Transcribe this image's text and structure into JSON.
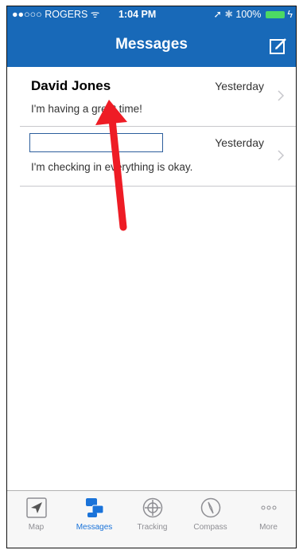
{
  "status_bar": {
    "carrier": "●●○○○ ROGERS",
    "time": "1:04 PM",
    "battery": "100%"
  },
  "nav": {
    "title": "Messages"
  },
  "messages": [
    {
      "sender": "David Jones",
      "time": "Yesterday",
      "preview": "I'm having a great time!"
    },
    {
      "sender": "",
      "time": "Yesterday",
      "preview": "I'm checking in everything is okay."
    }
  ],
  "tabs": [
    {
      "label": "Map",
      "icon": "location-arrow-icon",
      "active": false
    },
    {
      "label": "Messages",
      "icon": "messages-icon",
      "active": true
    },
    {
      "label": "Tracking",
      "icon": "crosshair-icon",
      "active": false
    },
    {
      "label": "Compass",
      "icon": "compass-icon",
      "active": false
    },
    {
      "label": "More",
      "icon": "more-dots-icon",
      "active": false
    }
  ],
  "colors": {
    "nav_bar": "#1869b8",
    "active_tab": "#1a73d9",
    "annotation_arrow": "#ee1c25"
  }
}
